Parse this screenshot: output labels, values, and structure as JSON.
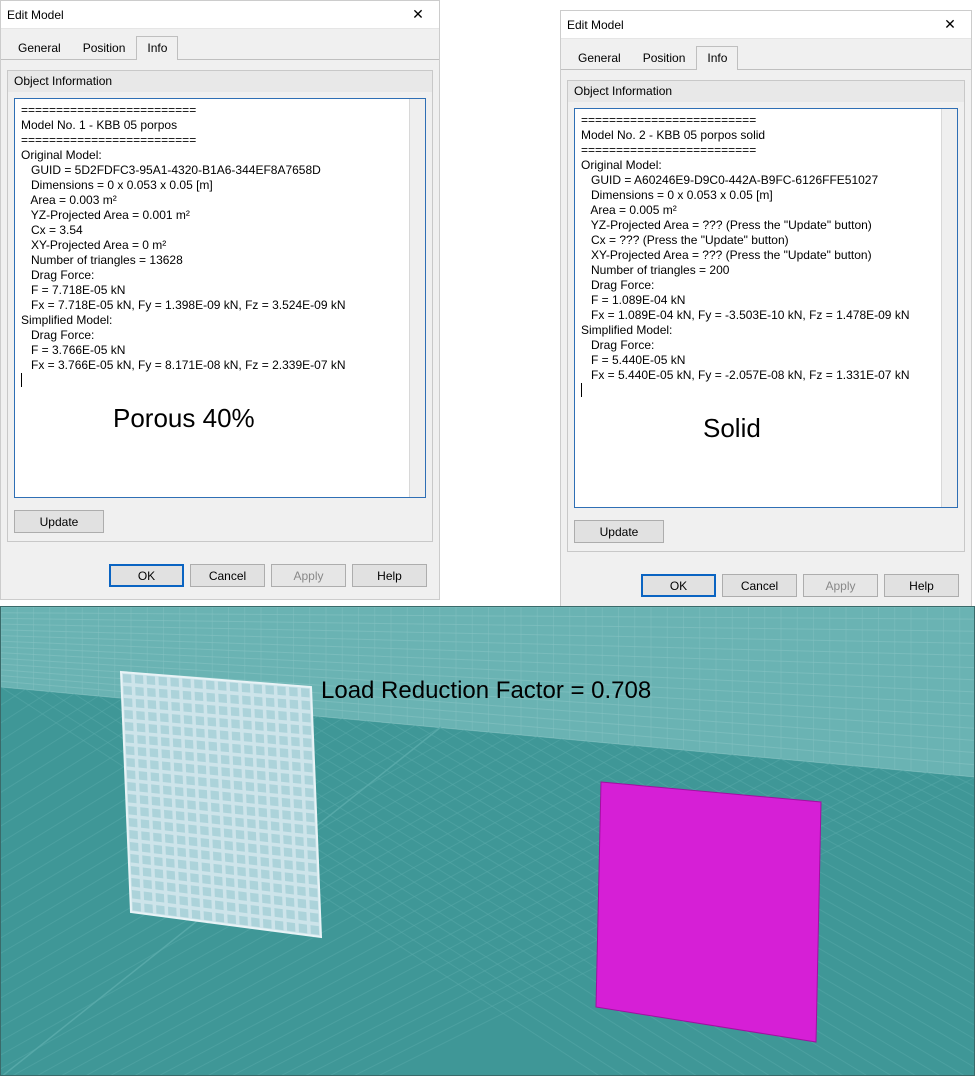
{
  "dialogs": {
    "left": {
      "title": "Edit Model",
      "close": "✕",
      "tabs": {
        "general": "General",
        "position": "Position",
        "info": "Info"
      },
      "group_title": "Object Information",
      "info_text": "=========================\nModel No. 1 - KBB 05 porpos\n=========================\nOriginal Model:\n   GUID = 5D2FDFC3-95A1-4320-B1A6-344EF8A7658D\n   Dimensions = 0 x 0.053 x 0.05 [m]\n   Area = 0.003 m²\n   YZ-Projected Area = 0.001 m²\n   Cx = 3.54\n   XY-Projected Area = 0 m²\n   Number of triangles = 13628\n   Drag Force:\n   F = 7.718E-05 kN\n   Fx = 7.718E-05 kN, Fy = 1.398E-09 kN, Fz = 3.524E-09 kN\nSimplified Model:\n   Drag Force:\n   F = 3.766E-05 kN\n   Fx = 3.766E-05 kN, Fy = 8.171E-08 kN, Fz = 2.339E-07 kN\n",
      "overlay": "Porous 40%",
      "update": "Update",
      "ok": "OK",
      "cancel": "Cancel",
      "apply": "Apply",
      "help": "Help"
    },
    "right": {
      "title": "Edit Model",
      "close": "✕",
      "tabs": {
        "general": "General",
        "position": "Position",
        "info": "Info"
      },
      "group_title": "Object Information",
      "info_text": "=========================\nModel No. 2 - KBB 05 porpos solid\n=========================\nOriginal Model:\n   GUID = A60246E9-D9C0-442A-B9FC-6126FFE51027\n   Dimensions = 0 x 0.053 x 0.05 [m]\n   Area = 0.005 m²\n   YZ-Projected Area = ??? (Press the \"Update\" button)\n   Cx = ??? (Press the \"Update\" button)\n   XY-Projected Area = ??? (Press the \"Update\" button)\n   Number of triangles = 200\n   Drag Force:\n   F = 1.089E-04 kN\n   Fx = 1.089E-04 kN, Fy = -3.503E-10 kN, Fz = 1.478E-09 kN\nSimplified Model:\n   Drag Force:\n   F = 5.440E-05 kN\n   Fx = 5.440E-05 kN, Fy = -2.057E-08 kN, Fz = 1.331E-07 kN\n",
      "overlay": "Solid",
      "update": "Update",
      "ok": "OK",
      "cancel": "Cancel",
      "apply": "Apply",
      "help": "Help"
    }
  },
  "viewport": {
    "load_label": "Load Reduction Factor = 0.708",
    "colors": {
      "floor": "#3f9797",
      "floor_grid": "#59aaaa",
      "wall": "#6ab3b3",
      "wall_grid": "#86c3c3",
      "porous_panel": "#cde4ea",
      "porous_hole": "#a8d0d8",
      "solid_panel": "#d61fd6"
    }
  }
}
